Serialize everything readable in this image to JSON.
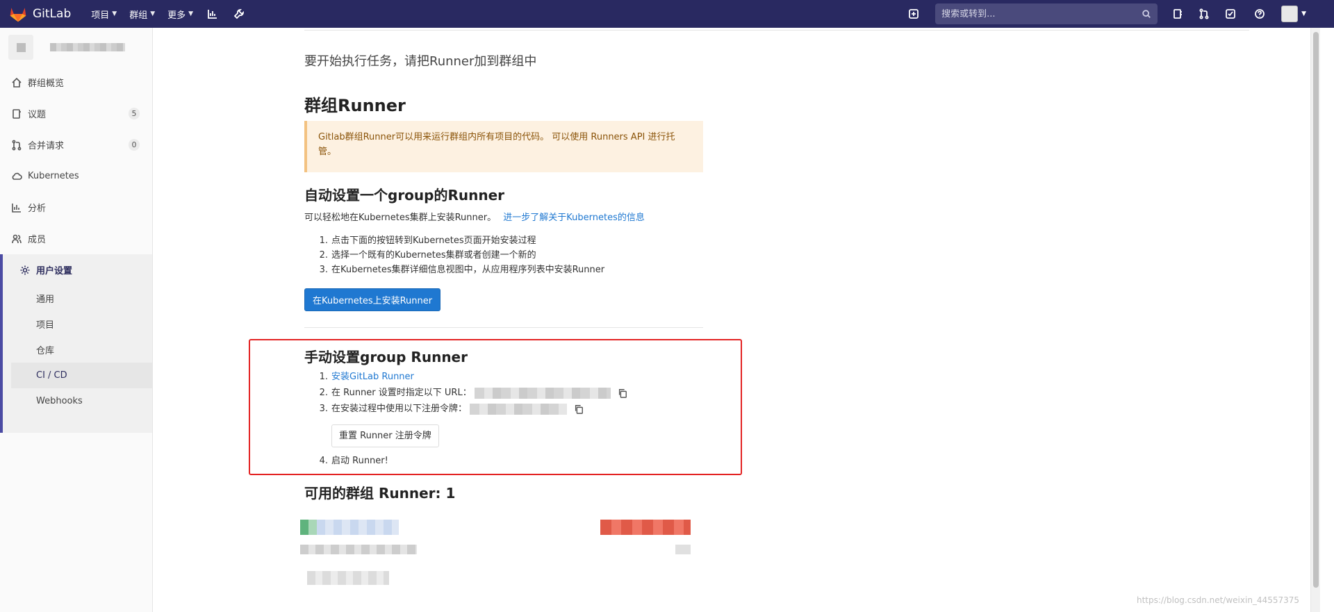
{
  "navbar": {
    "brand": "GitLab",
    "menu": [
      {
        "label": "项目"
      },
      {
        "label": "群组"
      },
      {
        "label": "更多"
      }
    ],
    "search_placeholder": "搜索或转到..."
  },
  "sidebar": {
    "items": [
      {
        "label": "群组概览",
        "icon": "home-icon"
      },
      {
        "label": "议题",
        "icon": "issues-icon",
        "badge": "5"
      },
      {
        "label": "合并请求",
        "icon": "merge-request-icon",
        "badge": "0"
      },
      {
        "label": "Kubernetes",
        "icon": "cloud-icon"
      },
      {
        "label": "分析",
        "icon": "chart-icon"
      },
      {
        "label": "成员",
        "icon": "users-icon"
      }
    ],
    "active": {
      "label": "用户设置",
      "icon": "gear-icon",
      "subitems": [
        {
          "label": "通用"
        },
        {
          "label": "项目"
        },
        {
          "label": "仓库"
        },
        {
          "label": "CI / CD",
          "current": true
        },
        {
          "label": "Webhooks"
        }
      ]
    }
  },
  "content": {
    "intro": "要开始执行任务，请把Runner加到群组中",
    "group_runner_title": "群组Runner",
    "alert_text": "Gitlab群组Runner可以用来运行群组内所有项目的代码。 可以使用 Runners API 进行托管。",
    "auto": {
      "title": "自动设置一个group的Runner",
      "desc": "可以轻松地在Kubernetes集群上安装Runner。",
      "link": "进一步了解关于Kubernetes的信息",
      "steps": [
        "点击下面的按钮转到Kubernetes页面开始安装过程",
        "选择一个既有的Kubernetes集群或者创建一个新的",
        "在Kubernetes集群详细信息视图中，从应用程序列表中安装Runner"
      ],
      "button": "在Kubernetes上安装Runner"
    },
    "manual": {
      "title": "手动设置group Runner",
      "step1_link": "安装GitLab Runner",
      "step2": "在 Runner 设置时指定以下 URL：",
      "step3": "在安装过程中使用以下注册令牌：",
      "reset_button": "重置 Runner 注册令牌",
      "step4": "启动 Runner!"
    },
    "available_title": "可用的群组 Runner: 1",
    "accent_color": "#1f78d1",
    "highlight_color": "#e32222"
  },
  "watermark": "https://blog.csdn.net/weixin_44557375"
}
